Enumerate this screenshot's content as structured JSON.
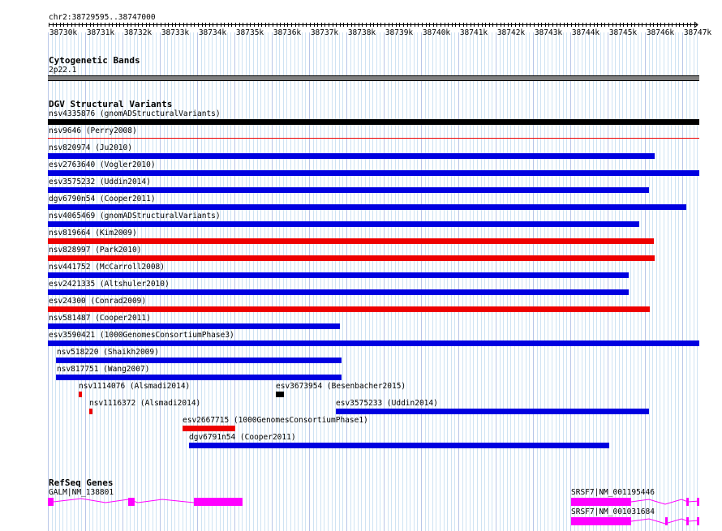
{
  "ruler": {
    "range": "chr2:38729595..38747000",
    "ticks": [
      "38730k",
      "38731k",
      "38732k",
      "38733k",
      "38734k",
      "38735k",
      "38736k",
      "38737k",
      "38738k",
      "38739k",
      "38740k",
      "38741k",
      "38742k",
      "38743k",
      "38744k",
      "38745k",
      "38746k",
      "38747k"
    ]
  },
  "cytoband": {
    "title": "Cytogenetic Bands",
    "band": "2p22.1"
  },
  "dgv": {
    "title": "DGV Structural Variants",
    "colors": {
      "gain": "#0000e0",
      "loss": "#ee0000",
      "complex": "#000000"
    },
    "features": [
      {
        "label": "nsv4335876 (gnomADStructuralVariants)"
      },
      {
        "label": "nsv9646 (Perry2008)"
      },
      {
        "label": "nsv820974 (Ju2010)"
      },
      {
        "label": "esv2763640 (Vogler2010)"
      },
      {
        "label": "esv3575232 (Uddin2014)"
      },
      {
        "label": "dgv6790n54 (Cooper2011)"
      },
      {
        "label": "nsv4065469 (gnomADStructuralVariants)"
      },
      {
        "label": "nsv819664 (Kim2009)"
      },
      {
        "label": "nsv828997 (Park2010)"
      },
      {
        "label": "nsv441752 (McCarroll2008)"
      },
      {
        "label": "esv2421335 (Altshuler2010)"
      },
      {
        "label": "esv24300 (Conrad2009)"
      },
      {
        "label": "nsv581487 (Cooper2011)"
      },
      {
        "label": "esv3590421 (1000GenomesConsortiumPhase3)"
      },
      {
        "label": "nsv518220 (Shaikh2009)"
      },
      {
        "label": "nsv817751 (Wang2007)"
      },
      {
        "label": "nsv1114076 (Alsmadi2014)"
      },
      {
        "label": "esv3673954 (Besenbacher2015)"
      },
      {
        "label": "nsv1116372 (Alsmadi2014)"
      },
      {
        "label": "esv3575233 (Uddin2014)"
      },
      {
        "label": "esv2667715 (1000GenomesConsortiumPhase1)"
      },
      {
        "label": "dgv6791n54 (Cooper2011)"
      }
    ]
  },
  "refseq": {
    "title": "RefSeq Genes",
    "color": "#ff00ff",
    "genes": [
      {
        "label": "GALM|NM_138801"
      },
      {
        "label": "SRSF7|NM_001195446"
      },
      {
        "label": "SRSF7|NM_001031684"
      }
    ]
  }
}
